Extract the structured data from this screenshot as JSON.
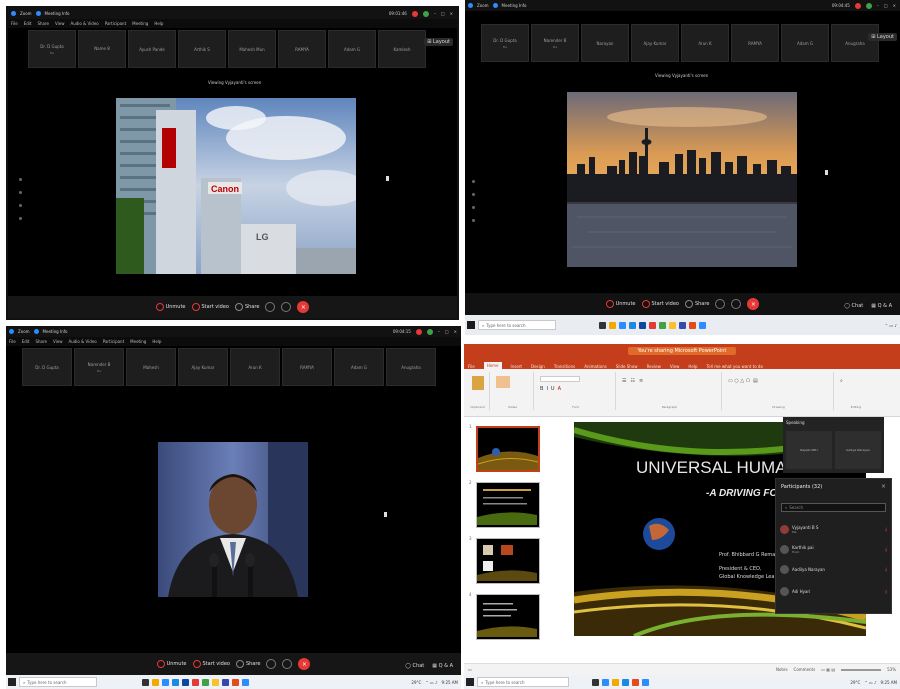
{
  "q1": {
    "app": "Zoom",
    "meeting": "Meeting Info",
    "menu": [
      "File",
      "Edit",
      "Share",
      "View",
      "Audio & Video",
      "Participant",
      "Meeting",
      "Help"
    ],
    "clock": "09:01:46",
    "participants": [
      {
        "name": "Dr. D Gupta",
        "sub": "Me"
      },
      {
        "name": "Name 8",
        "sub": ""
      },
      {
        "name": "Ayush Pande",
        "sub": ""
      },
      {
        "name": "Arthik S",
        "sub": ""
      },
      {
        "name": "Mahesh Mun",
        "sub": ""
      },
      {
        "name": "RAMYA",
        "sub": ""
      },
      {
        "name": "Adam G",
        "sub": ""
      },
      {
        "name": "Kamlesh",
        "sub": ""
      }
    ],
    "layout_label": "Layout",
    "viewing": "Viewing Vyjayanti's screen",
    "toolbar": {
      "unmute": "Unmute",
      "video": "Start video",
      "share": "Share"
    }
  },
  "q2": {
    "app": "Zoom",
    "meeting": "Meeting Info",
    "clock": "09:04:45",
    "participants": [
      {
        "name": "Dr. D Gupta",
        "sub": "Me"
      },
      {
        "name": "Narender B",
        "sub": "Me"
      },
      {
        "name": "Narayan",
        "sub": ""
      },
      {
        "name": "Ajay Kumar",
        "sub": ""
      },
      {
        "name": "Arun K",
        "sub": ""
      },
      {
        "name": "RAMYA",
        "sub": ""
      },
      {
        "name": "Adam G",
        "sub": ""
      },
      {
        "name": "Anugraha",
        "sub": ""
      }
    ],
    "layout_label": "Layout",
    "viewing": "Viewing Vyjayanti's screen",
    "toolbar": {
      "unmute": "Unmute",
      "video": "Start video",
      "share": "Share",
      "chat": "Chat",
      "qa": "Q & A"
    },
    "search": "Type here to search"
  },
  "q3": {
    "app": "Zoom",
    "meeting": "Meeting Info",
    "menu": [
      "File",
      "Edit",
      "Share",
      "View",
      "Audio & Video",
      "Participant",
      "Meeting",
      "Help"
    ],
    "clock": "09:04:15",
    "participants": [
      {
        "name": "Dr. D Gupta",
        "sub": ""
      },
      {
        "name": "Narender B",
        "sub": "Me"
      },
      {
        "name": "Mahesh",
        "sub": ""
      },
      {
        "name": "Ajay Kumar",
        "sub": ""
      },
      {
        "name": "Arun K",
        "sub": ""
      },
      {
        "name": "RAMYA",
        "sub": ""
      },
      {
        "name": "Adam G",
        "sub": ""
      },
      {
        "name": "Anugraha",
        "sub": ""
      }
    ],
    "toolbar": {
      "unmute": "Unmute",
      "video": "Start video",
      "share": "Share",
      "chat": "Chat",
      "qa": "Q & A"
    },
    "search": "Type here to search",
    "tray": {
      "weather": "29°C",
      "time": "9:25 AM"
    }
  },
  "q4": {
    "banner": "You're sharing Microsoft PowerPoint",
    "tabs": [
      "File",
      "Home",
      "Insert",
      "Design",
      "Transitions",
      "Animations",
      "Slide Show",
      "Review",
      "View",
      "Help",
      "Tell me what you want to do"
    ],
    "active_tab": "Home",
    "groups": [
      "Clipboard",
      "Slides",
      "Font",
      "Paragraph",
      "Drawing",
      "Editing"
    ],
    "slide_title": "UNIVERSAL HUMAN V",
    "slide_subtitle": "-A DRIVING FORC",
    "slide_author": "Prof. Bhibbard G Remar",
    "slide_role1": "President & CEO,",
    "slide_role2": "Global Knowledge Lea",
    "speaking": "Speaking",
    "top_tiles": [
      {
        "name": "Rajesh KBU",
        "sub": ""
      },
      {
        "name": "Aalhya Narayan",
        "sub": ""
      }
    ],
    "panel_title": "Participants (32)",
    "panel_search": "Search",
    "panel_rows": [
      {
        "name": "Vyjayanti B S",
        "sub": "Me"
      },
      {
        "name": "Karthik pai",
        "sub": "Host"
      },
      {
        "name": "Aadilya Narayan",
        "sub": ""
      },
      {
        "name": "Adi Hyari",
        "sub": ""
      }
    ],
    "status": {
      "notes": "Notes",
      "comments": "Comments",
      "zoom": "53%"
    },
    "search": "Type here to search",
    "tray": {
      "weather": "29°C",
      "time": "9:25 AM"
    }
  }
}
